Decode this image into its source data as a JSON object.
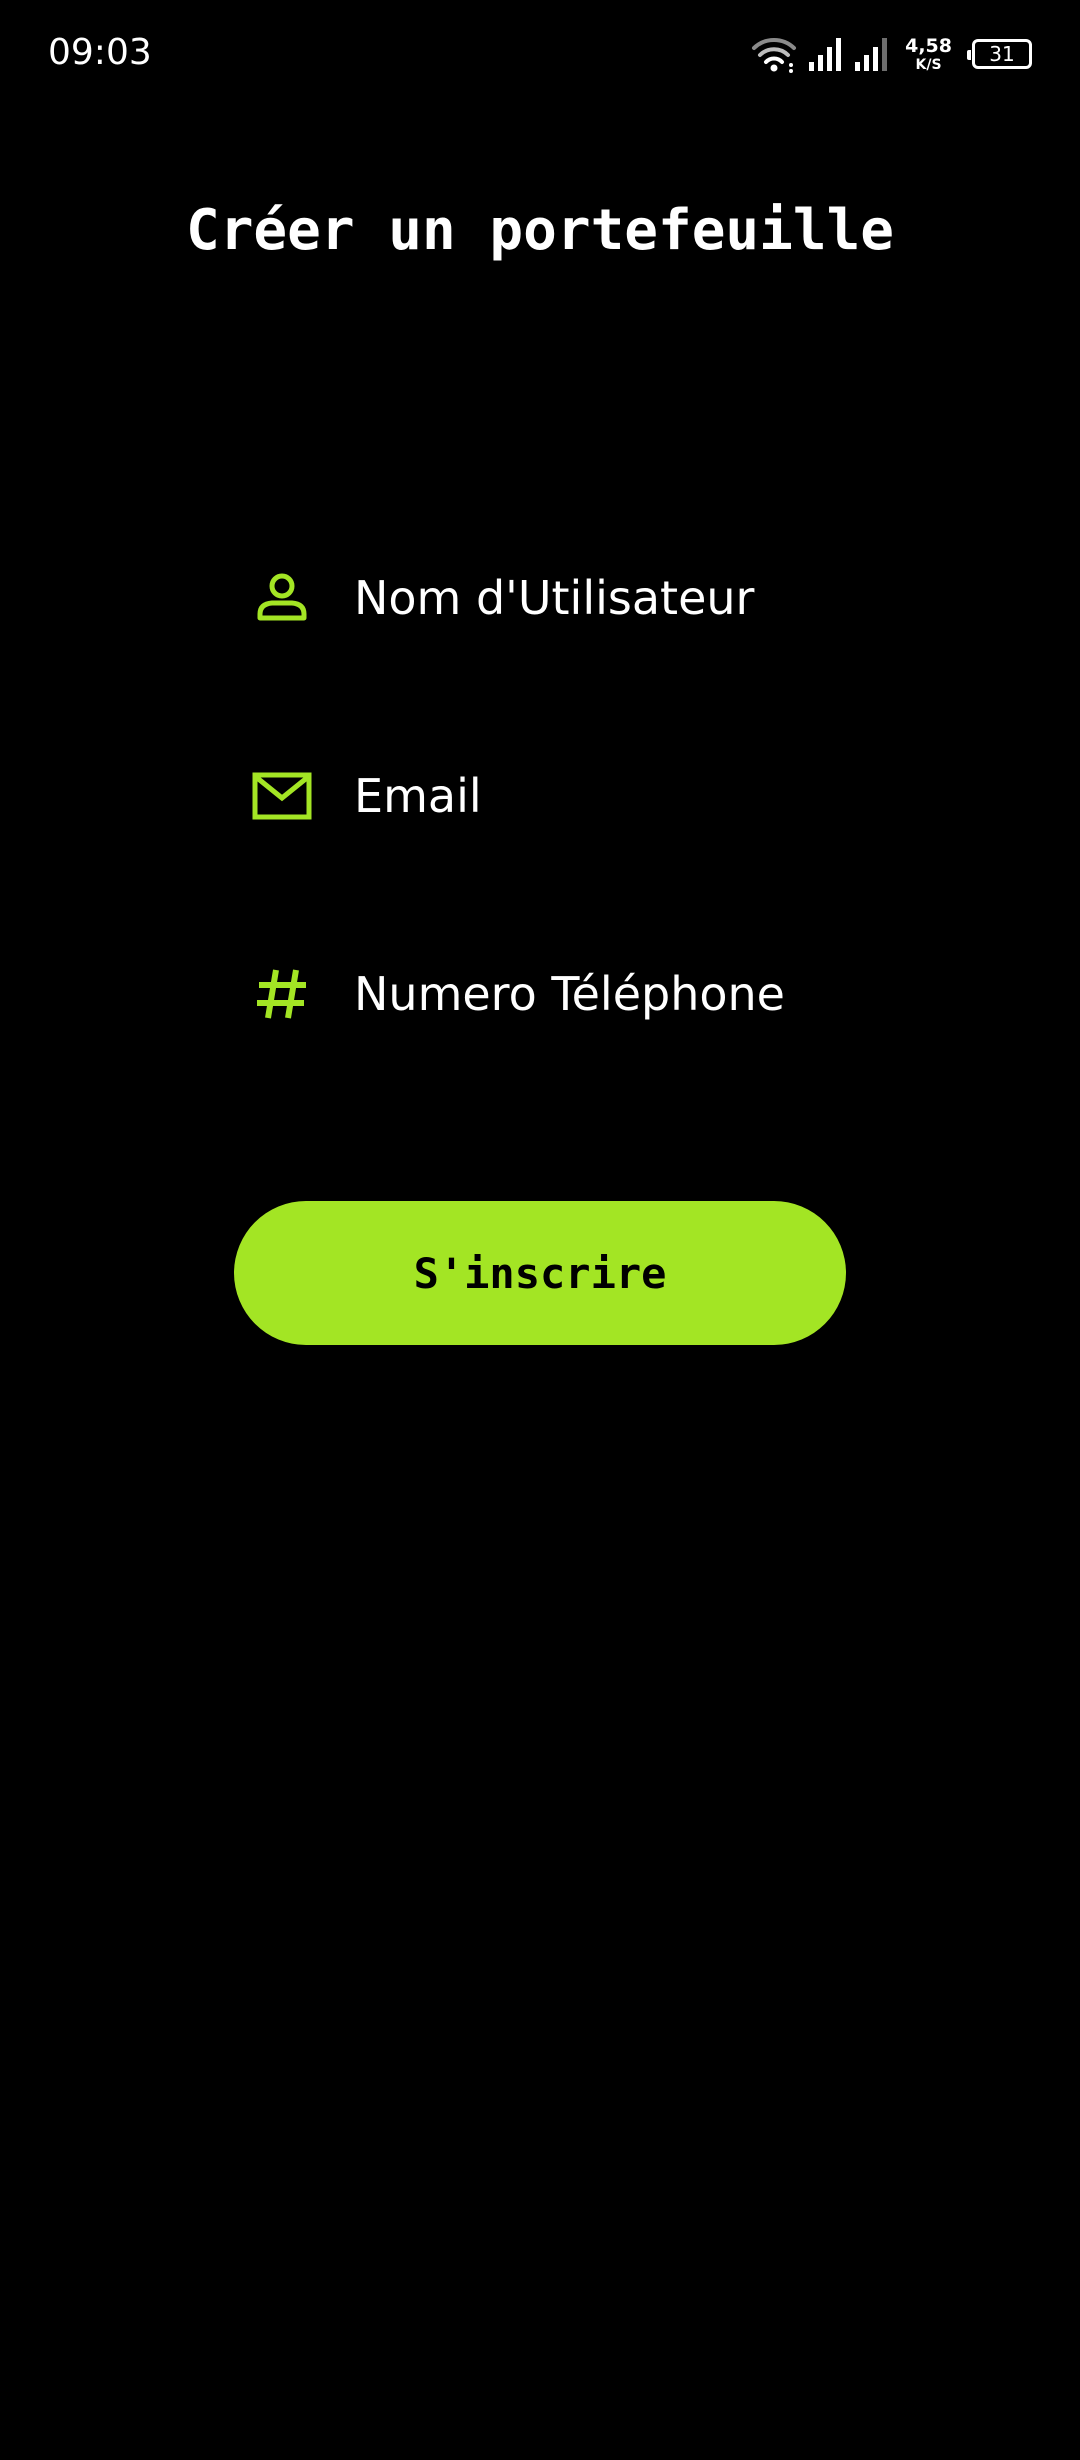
{
  "status_bar": {
    "time": "09:03",
    "net_speed_value": "4,58",
    "net_speed_unit": "K/S",
    "battery_level": "31"
  },
  "page": {
    "title": "Créer un portefeuille"
  },
  "form": {
    "fields": [
      {
        "icon": "person-icon",
        "label": "Nom d'Utilisateur"
      },
      {
        "icon": "mail-icon",
        "label": "Email"
      },
      {
        "icon": "hash-icon",
        "label": "Numero Téléphone"
      }
    ],
    "submit_label": "S'inscrire"
  },
  "colors": {
    "background": "#000000",
    "accent": "#a3e524",
    "text": "#ffffff"
  }
}
